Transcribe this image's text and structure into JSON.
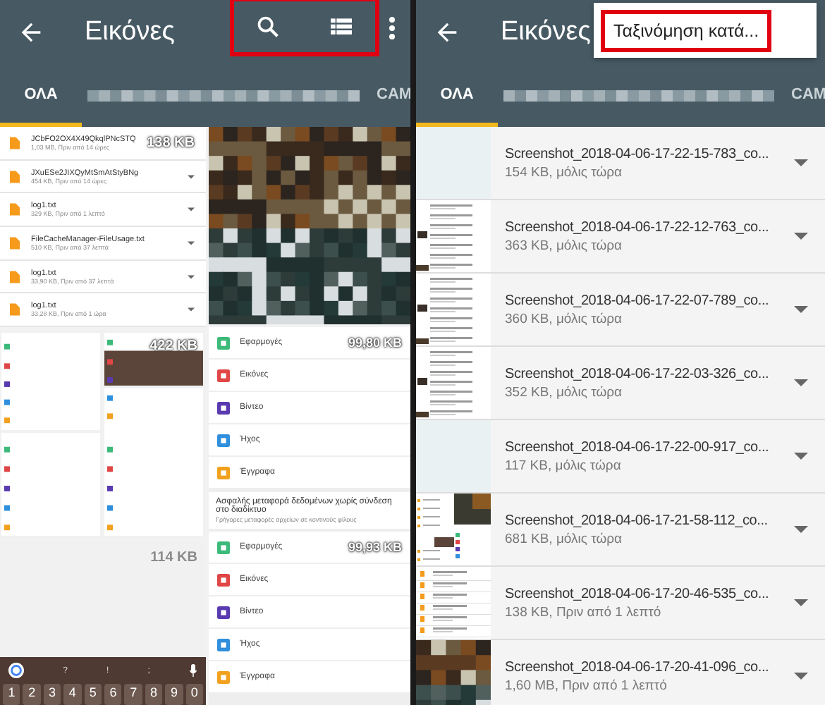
{
  "left": {
    "app_bar": {
      "title": "Εικόνες",
      "highlight": true
    },
    "tabs": [
      {
        "label": "ΟΛΑ",
        "selected": true
      },
      {
        "label": "CAM",
        "selected": false
      }
    ],
    "files_tile": {
      "size": "138 KB",
      "files": [
        {
          "name": "JCbFO2OX4X49QkqlPNcSTQ",
          "meta": "1,03 MB, Πριν από 14 ώρες"
        },
        {
          "name": "JXuESe2JIXQyMtSmAtStyBNg",
          "meta": "454 KB, Πριν από 14 ώρες"
        },
        {
          "name": "log1.txt",
          "meta": "329 KB, Πριν από 1 λεπτό"
        },
        {
          "name": "FileCacheManager-FileUsage.txt",
          "meta": "510 KB, Πριν από 37 λεπτά"
        },
        {
          "name": "log1.txt",
          "meta": "33,90 KB, Πριν από 37 λεπτά"
        },
        {
          "name": "log1.txt",
          "meta": "33,28 KB, Πριν από 1 ώρα"
        }
      ]
    },
    "screens_tile": {
      "size": "422 KB"
    },
    "keyboard_tile": {
      "size": "114 KB",
      "top_keys": [
        "?",
        "!",
        ";"
      ],
      "digits": [
        "1",
        "2",
        "3",
        "4",
        "5",
        "6",
        "7",
        "8",
        "9",
        "0"
      ]
    },
    "categories_tile": {
      "sections": [
        {
          "kind": "list",
          "items": [
            {
              "label": "Εφαρμογές",
              "size": "99,80 KB",
              "color": "#3dba7a"
            },
            {
              "label": "Εικόνες",
              "color": "#e04646"
            },
            {
              "label": "Βίντεο",
              "color": "#5a3ab0"
            },
            {
              "label": "Ήχος",
              "color": "#2f8fdc"
            },
            {
              "label": "Έγγραφα",
              "color": "#f2a11f"
            }
          ]
        },
        {
          "kind": "banner",
          "title": "Ασφαλής μεταφορά δεδομένων χωρίς σύνδεση στο διαδίκτυο",
          "subtitle": "Γρήγορες μεταφορές αρχείων σε κοντινούς φίλους"
        },
        {
          "kind": "list",
          "items": [
            {
              "label": "Εφαρμογές",
              "size": "99,93 KB",
              "color": "#3dba7a"
            },
            {
              "label": "Εικόνες",
              "color": "#e04646"
            },
            {
              "label": "Βίντεο",
              "color": "#5a3ab0"
            },
            {
              "label": "Ήχος",
              "color": "#2f8fdc"
            },
            {
              "label": "Έγγραφα",
              "color": "#f2a11f"
            }
          ]
        }
      ]
    }
  },
  "right": {
    "app_bar": {
      "title": "Εικόνες"
    },
    "menu": {
      "item": "Ταξινόμηση κατά...",
      "highlight": true
    },
    "tabs": [
      {
        "label": "ΟΛΑ",
        "selected": true
      },
      {
        "label": "CAM",
        "selected": false
      }
    ],
    "rows": [
      {
        "name": "Screenshot_2018-04-06-17-22-15-783_co...",
        "meta": "154 KB, μόλις τώρα"
      },
      {
        "name": "Screenshot_2018-04-06-17-22-12-763_co...",
        "meta": "363 KB, μόλις τώρα"
      },
      {
        "name": "Screenshot_2018-04-06-17-22-07-789_co...",
        "meta": "360 KB, μόλις τώρα"
      },
      {
        "name": "Screenshot_2018-04-06-17-22-03-326_co...",
        "meta": "352 KB, μόλις τώρα"
      },
      {
        "name": "Screenshot_2018-04-06-17-22-00-917_co...",
        "meta": "117 KB, μόλις τώρα"
      },
      {
        "name": "Screenshot_2018-04-06-17-21-58-112_co...",
        "meta": "681 KB, μόλις τώρα"
      },
      {
        "name": "Screenshot_2018-04-06-17-20-46-535_co...",
        "meta": "138 KB, Πριν από 1 λεπτό"
      },
      {
        "name": "Screenshot_2018-04-06-17-20-41-096_co...",
        "meta": "1,60 MB, Πριν από 1 λεπτό"
      }
    ]
  }
}
